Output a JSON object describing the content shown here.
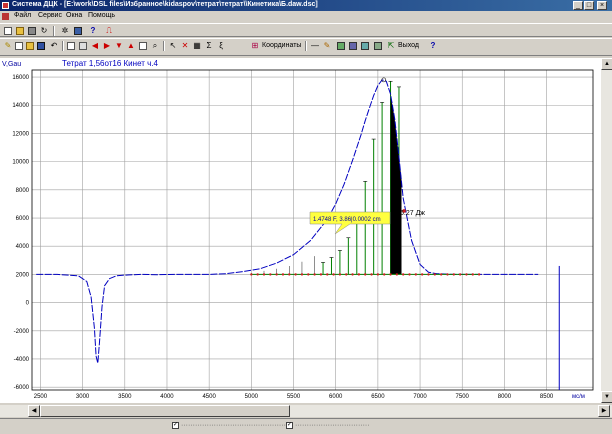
{
  "window": {
    "title": "Система ДЦК - [E:\\work\\DSL files\\Избранное\\kidaspov\\тетрат\\тетрат\\\\Кинетика\\Б.daw.dsc]",
    "buttons": [
      "_",
      "□",
      "×"
    ]
  },
  "menu": {
    "items": [
      "Файл",
      "Сервис",
      "Окна",
      "Помощь"
    ]
  },
  "toolbar2": {
    "axes_label": "Координаты",
    "exit_label": "Выход"
  },
  "plot": {
    "panel_title": "Тетрат 1,56от16 Кинет ч.4",
    "y_unit": "V,Gau",
    "x_unit": "мс/м",
    "tooltip": "1.4748 F, 3.86|0.0002 cm",
    "annotation": "6.27 Дж"
  },
  "chart_data": {
    "type": "line",
    "xlim": [
      2400,
      9050
    ],
    "ylim": [
      -6200,
      16500
    ],
    "xticks": [
      2500,
      3000,
      3500,
      4000,
      4500,
      5000,
      5500,
      6000,
      6500,
      7000,
      7500,
      8000,
      8500
    ],
    "xtick_labels": [
      "2500",
      "3000",
      "3500",
      "4000",
      "4500",
      "5000",
      "5500",
      "6000",
      "6500",
      "7000",
      "7500",
      "8000",
      "8500"
    ],
    "yticks": [
      16000,
      14000,
      12000,
      10000,
      8000,
      6000,
      4000,
      2000,
      0,
      -2000,
      -4000,
      -6000
    ],
    "ytick_labels": [
      "16000",
      "14000",
      "12000",
      "10000",
      "8000",
      "6000",
      "4000",
      "2000",
      "0",
      "-2000",
      "-4000",
      "-6000"
    ],
    "grid": true,
    "series": [
      {
        "color": "#0000c0",
        "x": [
          2450,
          2700,
          2950,
          3050,
          3100,
          3140,
          3160,
          3180,
          3200,
          3230,
          3260,
          3320,
          3400,
          3500,
          3700,
          3900,
          4100,
          4300,
          4500,
          4700,
          4900,
          5100,
          5300,
          5500,
          5700,
          5900,
          6000,
          6100,
          6200,
          6300,
          6350,
          6400,
          6450,
          6500,
          6550,
          6600,
          6650,
          6700,
          6750,
          6800,
          6900,
          7000,
          7100,
          7200,
          7400,
          7600,
          7800,
          8000,
          8200,
          8400
        ],
        "y": [
          2000,
          2000,
          1900,
          1500,
          400,
          -1800,
          -3800,
          -4300,
          -2800,
          -300,
          1200,
          1700,
          1900,
          1950,
          2000,
          1980,
          2000,
          2000,
          2000,
          2050,
          2200,
          2400,
          2800,
          3400,
          4400,
          5900,
          7000,
          8400,
          10100,
          11900,
          12900,
          13800,
          14700,
          15400,
          15800,
          15700,
          14800,
          13000,
          10300,
          7400,
          4400,
          2700,
          2150,
          2050,
          2000,
          2000,
          2000,
          2000,
          2000,
          2000
        ]
      }
    ],
    "stems": {
      "color": "#008000",
      "x": [
        5850,
        5950,
        6050,
        6150,
        6250,
        6350,
        6450,
        6550,
        6650,
        6750
      ],
      "y": [
        2850,
        3200,
        3700,
        4600,
        6200,
        8600,
        11600,
        14200,
        15700,
        15300
      ]
    },
    "markers": {
      "color": "#cc2020",
      "x": [
        6750,
        6800,
        6850,
        6900,
        6950,
        7000,
        7050,
        7100,
        7150,
        7200,
        7250,
        7300,
        7350,
        7400,
        7450,
        7500,
        7550,
        7600,
        7650,
        7700
      ]
    }
  }
}
